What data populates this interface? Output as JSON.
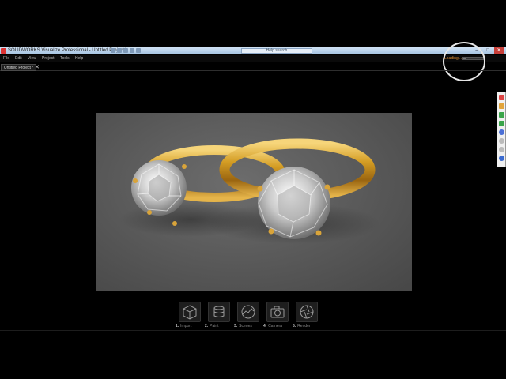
{
  "window": {
    "title": "SOLIDWORKS Visualize Professional - Untitled Project*",
    "quick_search": "Help search"
  },
  "menu": {
    "items": [
      "File",
      "Edit",
      "View",
      "Project",
      "Tools",
      "Help"
    ]
  },
  "status": {
    "loading_label": "Loading...",
    "progress": 0.15
  },
  "tabs": {
    "active_label": "Untitled Project *",
    "close_glyph": "✕"
  },
  "window_controls": {
    "minimize": "–",
    "maximize": "□",
    "close": "✕"
  },
  "steps": [
    {
      "number": "1.",
      "label": "Import",
      "icon": "cube-icon"
    },
    {
      "number": "2.",
      "label": "Paint",
      "icon": "paint-can-icon"
    },
    {
      "number": "3.",
      "label": "Scenes",
      "icon": "scene-icon"
    },
    {
      "number": "4.",
      "label": "Camera",
      "icon": "camera-icon"
    },
    {
      "number": "5.",
      "label": "Render",
      "icon": "aperture-icon"
    }
  ],
  "colors": {
    "background": "#000000",
    "viewport": "#5a5a5a",
    "gold": "#c8901a",
    "accent_loading": "#d98a2c"
  }
}
